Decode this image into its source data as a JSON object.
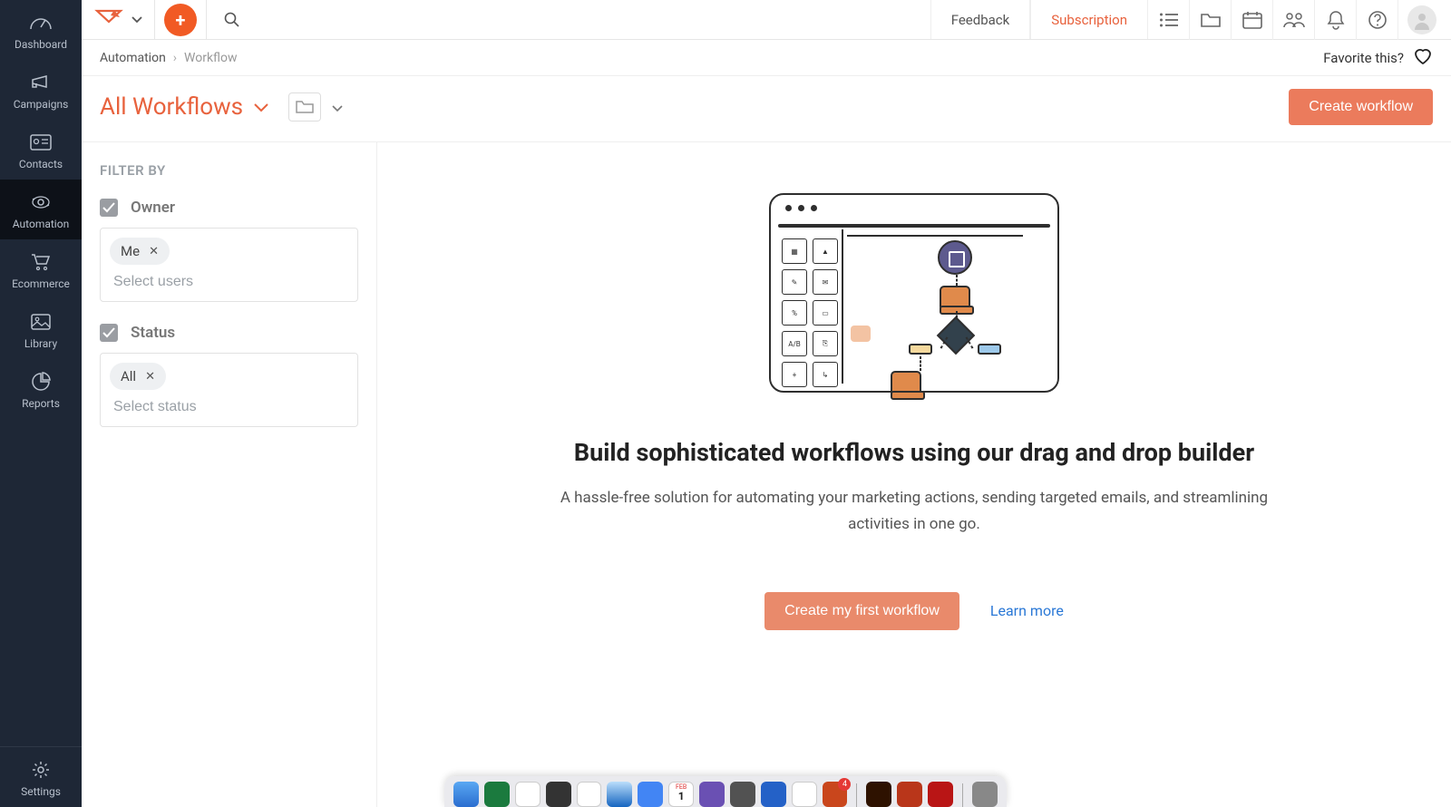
{
  "sidebar": {
    "items": [
      {
        "label": "Dashboard"
      },
      {
        "label": "Campaigns"
      },
      {
        "label": "Contacts"
      },
      {
        "label": "Automation"
      },
      {
        "label": "Ecommerce"
      },
      {
        "label": "Library"
      },
      {
        "label": "Reports"
      }
    ],
    "settings_label": "Settings"
  },
  "topbar": {
    "feedback": "Feedback",
    "subscription": "Subscription"
  },
  "breadcrumb": {
    "root": "Automation",
    "current": "Workflow",
    "favorite_label": "Favorite this?"
  },
  "title_row": {
    "title": "All Workflows",
    "create_btn": "Create workflow"
  },
  "filter": {
    "heading": "FILTER BY",
    "owner": {
      "label": "Owner",
      "chip": "Me",
      "placeholder": "Select users"
    },
    "status": {
      "label": "Status",
      "chip": "All",
      "placeholder": "Select status"
    }
  },
  "empty": {
    "title": "Build sophisticated workflows using our drag and drop builder",
    "subtitle": "A hassle-free solution for automating your marketing actions, sending targeted emails, and streamlining activities in one go.",
    "primary_btn": "Create my first workflow",
    "link": "Learn more"
  },
  "dock": {
    "cal_month": "FEB",
    "cal_day": "1"
  }
}
